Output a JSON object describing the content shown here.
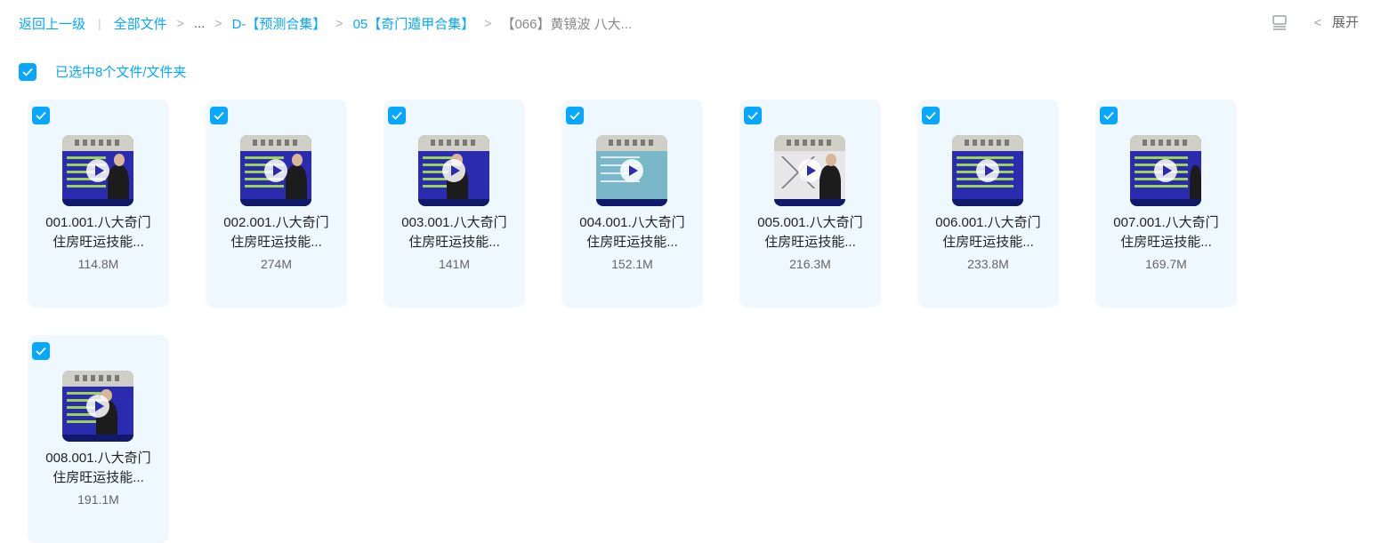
{
  "breadcrumb": {
    "back": "返回上一级",
    "all_files": "全部文件",
    "ellipsis": "...",
    "level1": "D-【预测合集】",
    "level2": "05【奇门遁甲合集】",
    "current": "【066】黄镜波 八大..."
  },
  "toolbar": {
    "expand_label": "展开",
    "list_icon": "list-view-icon",
    "chevron_icon": "chevron-left-icon"
  },
  "selection": {
    "label": "已选中8个文件/文件夹",
    "checked": true
  },
  "colors": {
    "accent": "#06a7ff",
    "card_bg": "#eff8fe"
  },
  "files": [
    {
      "name_line1": "001.001.八大奇门",
      "name_line2": "住房旺运技能...",
      "size": "114.8M",
      "checked": true
    },
    {
      "name_line1": "002.001.八大奇门",
      "name_line2": "住房旺运技能...",
      "size": "274M",
      "checked": true
    },
    {
      "name_line1": "003.001.八大奇门",
      "name_line2": "住房旺运技能...",
      "size": "141M",
      "checked": true
    },
    {
      "name_line1": "004.001.八大奇门",
      "name_line2": "住房旺运技能...",
      "size": "152.1M",
      "checked": true
    },
    {
      "name_line1": "005.001.八大奇门",
      "name_line2": "住房旺运技能...",
      "size": "216.3M",
      "checked": true
    },
    {
      "name_line1": "006.001.八大奇门",
      "name_line2": "住房旺运技能...",
      "size": "233.8M",
      "checked": true
    },
    {
      "name_line1": "007.001.八大奇门",
      "name_line2": "住房旺运技能...",
      "size": "169.7M",
      "checked": true
    },
    {
      "name_line1": "008.001.八大奇门",
      "name_line2": "住房旺运技能...",
      "size": "191.1M",
      "checked": true
    }
  ]
}
